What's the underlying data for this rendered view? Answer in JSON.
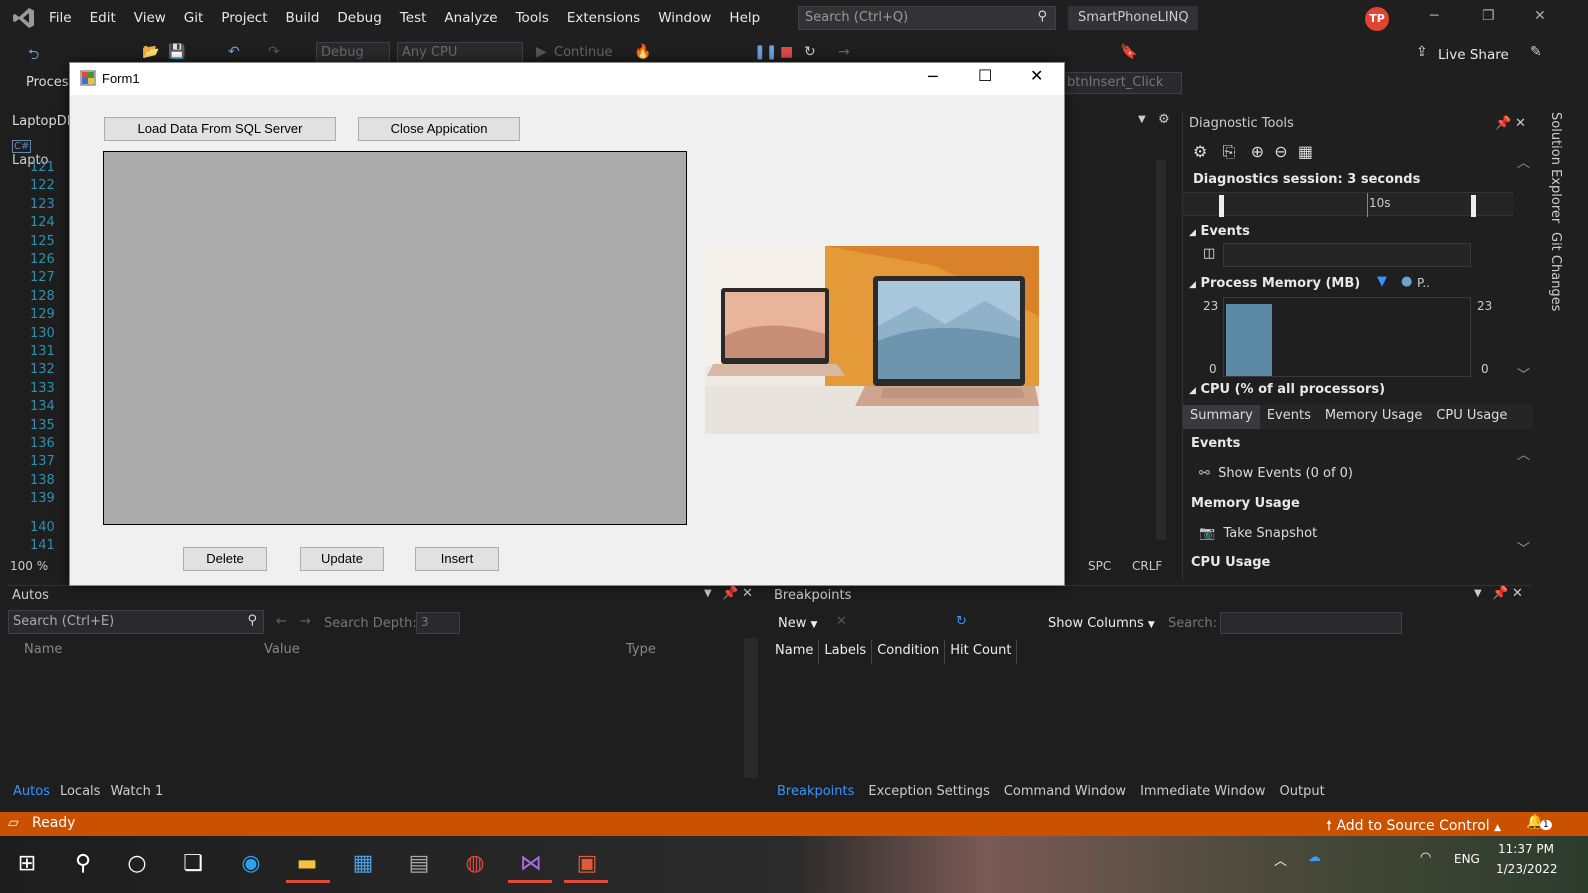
{
  "vs": {
    "menu": [
      "File",
      "Edit",
      "View",
      "Git",
      "Project",
      "Build",
      "Debug",
      "Test",
      "Analyze",
      "Tools",
      "Extensions",
      "Window",
      "Help"
    ],
    "search_placeholder": "Search (Ctrl+Q)",
    "solution_name": "SmartPhoneLINQ",
    "avatar_initials": "TP",
    "live_share": "Live Share",
    "config_combo": "Debug",
    "platform_combo": "Any CPU",
    "continue_label": "Continue",
    "process_label": "Proces",
    "method_combo": "btnInsert_Click",
    "file_tab": "LaptopDI",
    "file_tab2": "Lapto",
    "line_numbers": [
      "121",
      "122",
      "123",
      "124",
      "125",
      "126",
      "127",
      "128",
      "129",
      "130",
      "131",
      "132",
      "133",
      "134",
      "135",
      "136",
      "137",
      "138",
      "139",
      "140",
      "141"
    ],
    "zoom": "100 %",
    "spc": "SPC",
    "crlf": "CRLF",
    "accent": "#ca5100"
  },
  "form": {
    "title": "Form1",
    "load_button": "Load Data From SQL Server",
    "close_button": "Close Appication",
    "delete_button": "Delete",
    "update_button": "Update",
    "insert_button": "Insert"
  },
  "diagnostics": {
    "title": "Diagnostic Tools",
    "session": "Diagnostics session: 3 seconds",
    "timeline_label": "10s",
    "events_label": "Events",
    "process_memory_label": "Process Memory (MB)",
    "legend_p": "P..",
    "mem_max": "23",
    "mem_min": "0",
    "mem_max_r": "23",
    "mem_min_r": "0",
    "cpu_label": "CPU (% of all processors)",
    "tabs": [
      "Summary",
      "Events",
      "Memory Usage",
      "CPU Usage"
    ],
    "events_header": "Events",
    "show_events": "Show Events (0 of 0)",
    "memory_header": "Memory Usage",
    "take_snapshot": "Take Snapshot",
    "cpu_header": "CPU Usage"
  },
  "side_tabs": [
    "Solution Explorer",
    "Git Changes"
  ],
  "autos": {
    "title": "Autos",
    "search_placeholder": "Search (Ctrl+E)",
    "search_depth_label": "Search Depth:",
    "search_depth": "3",
    "columns": [
      "Name",
      "Value",
      "Type"
    ],
    "tabs": [
      "Autos",
      "Locals",
      "Watch 1"
    ]
  },
  "breakpoints": {
    "title": "Breakpoints",
    "new_label": "New",
    "show_columns": "Show Columns",
    "search_label": "Search:",
    "columns": [
      "Name",
      "Labels",
      "Condition",
      "Hit Count"
    ],
    "tabs": [
      "Breakpoints",
      "Exception Settings",
      "Command Window",
      "Immediate Window",
      "Output"
    ]
  },
  "status": {
    "ready": "Ready",
    "source_control": "Add to Source Control",
    "notification_count": "1"
  },
  "taskbar": {
    "lang": "ENG",
    "time": "11:37 PM",
    "date": "1/23/2022"
  }
}
